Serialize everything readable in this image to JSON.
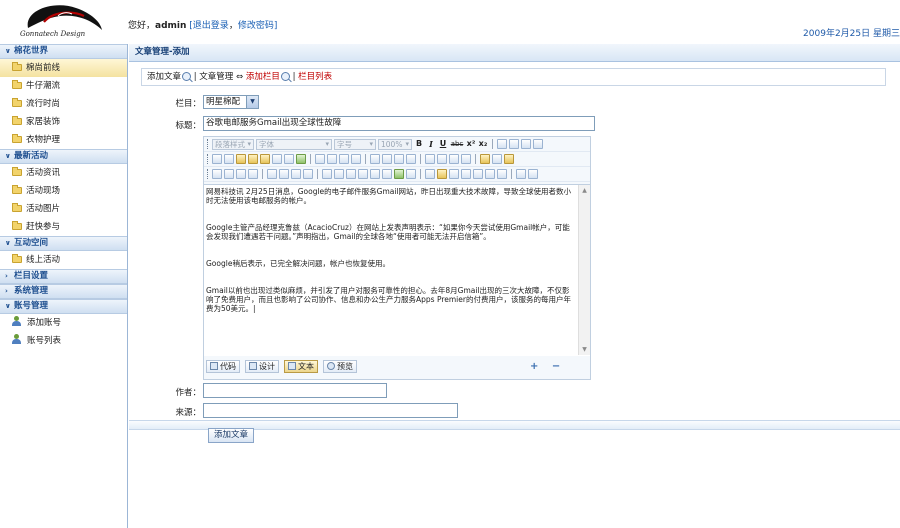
{
  "header": {
    "logo_text": "Gonnatech Design",
    "welcome_prefix": "您好，",
    "username": "admin",
    "bracket_open": "[",
    "logout_label": "退出登录",
    "comma": "，",
    "change_password_label": "修改密码",
    "bracket_close": "]",
    "datetime": "2009年2月25日 星期三"
  },
  "sidebar": {
    "sections": [
      {
        "title": "棉花世界",
        "items": [
          "棉尚前线",
          "牛仔潮流",
          "流行时尚",
          "家居装饰",
          "衣物护理"
        ]
      },
      {
        "title": "最新活动",
        "items": [
          "活动资讯",
          "活动现场",
          "活动图片",
          "赶快参与"
        ]
      },
      {
        "title": "互动空间",
        "items": [
          "线上活动"
        ]
      },
      {
        "title": "栏目设置",
        "items": []
      },
      {
        "title": "系统管理",
        "items": []
      },
      {
        "title": "账号管理",
        "items": [
          "添加账号",
          "账号列表"
        ]
      }
    ]
  },
  "main": {
    "title": "文章管理-添加",
    "breadcrumb": {
      "add_article": "添加文章",
      "sep1": "|",
      "article_manage": "文章管理",
      "arrows": "⇔",
      "add_column": "添加栏目",
      "sep2": "|",
      "column_list": "栏目列表"
    },
    "form": {
      "column_label": "栏目：",
      "column_value": "明星棉配",
      "title_label": "标题：",
      "title_value": "谷歌电邮服务Gmail出现全球性故障",
      "author_label": "作者：",
      "author_value": "",
      "source_label": "来源：",
      "source_value": "",
      "submit_label": "添加文章"
    },
    "editor": {
      "style_combo": "段落样式",
      "font_combo": "字体",
      "size_combo": "字号",
      "zoom_combo": "100%",
      "bold": "B",
      "italic": "I",
      "underline": "U",
      "strike": "abc",
      "sup": "x²",
      "sub": "x₂",
      "paragraphs": [
        "网易科技讯 2月25日消息，Google的电子邮件服务Gmail网站，昨日出现重大技术故障，导致全球使用者数小时无法使用该电邮服务的帐户。",
        "Google主管产品经理克鲁兹（AcacioCruz）在网站上发表声明表示：“如果你今天尝试使用Gmail帐户，可能会发现我们遭遇若干问题。”声明指出，Gmail的全球各地“使用者可能无法开启信箱”。",
        "Google稍后表示，已完全解决问题，帐户也恢复使用。",
        "Gmail以前也出现过类似麻烦，并引发了用户对服务可靠性的担心。去年8月Gmail出现的三次大故障，不仅影响了免费用户，而且也影响了公司协作、信息和办公生产力服务Apps Premier的付费用户，该服务的每用户年费为50美元。|"
      ],
      "modes": [
        "代码",
        "设计",
        "文本",
        "预览"
      ],
      "resize_icons": "+ −"
    }
  }
}
